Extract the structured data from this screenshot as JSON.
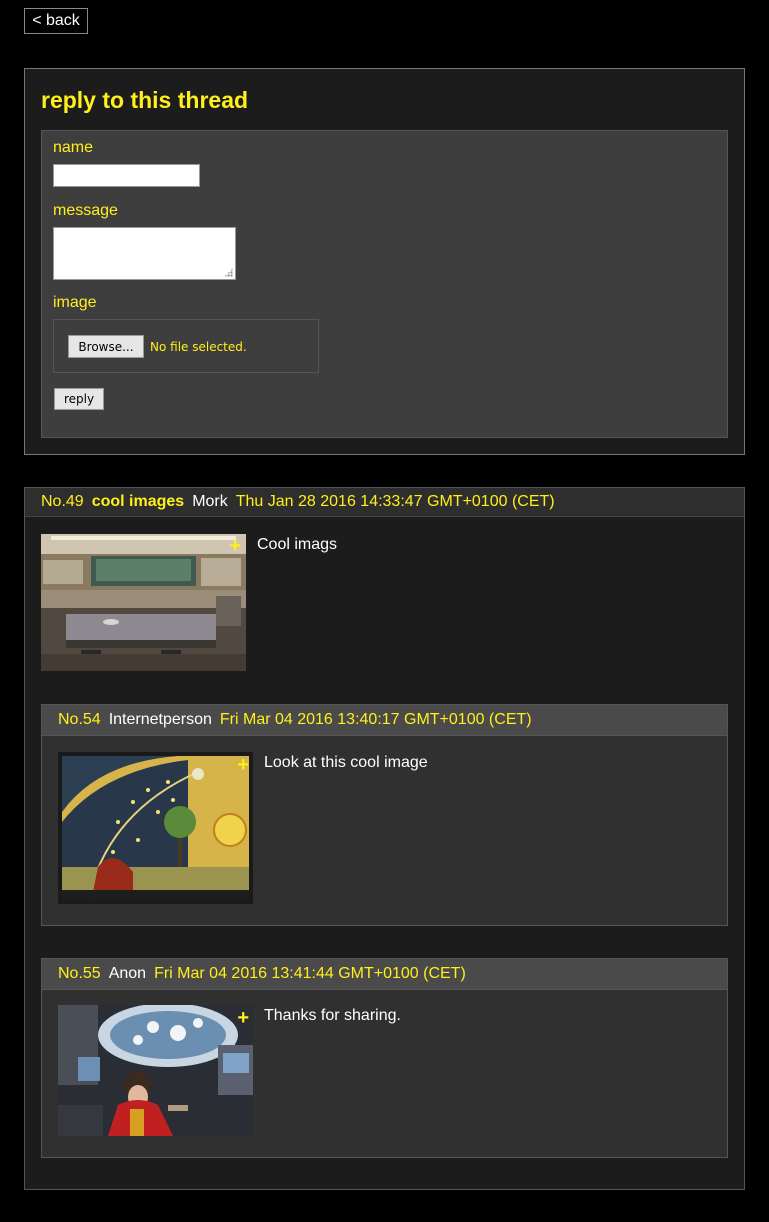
{
  "nav": {
    "back_label": "< back"
  },
  "reply_form": {
    "title": "reply to this thread",
    "name_label": "name",
    "message_label": "message",
    "image_label": "image",
    "browse_label": "Browse...",
    "file_status": "No file selected.",
    "submit_label": "reply",
    "name_value": "",
    "message_value": ""
  },
  "op": {
    "number": "No.49",
    "title": "cool images",
    "author": "Mork",
    "date": "Thu Jan 28 2016 14:33:47 GMT+0100 (CET)",
    "text": "Cool imags",
    "expand": "+"
  },
  "replies": [
    {
      "number": "No.54",
      "author": "Internetperson",
      "date": "Fri Mar 04 2016 13:40:17 GMT+0100 (CET)",
      "text": "Look at this cool image",
      "expand": "+"
    },
    {
      "number": "No.55",
      "author": "Anon",
      "date": "Fri Mar 04 2016 13:41:44 GMT+0100 (CET)",
      "text": "Thanks for sharing.",
      "expand": "+"
    }
  ],
  "colors": {
    "accent": "#ffef1a",
    "background": "#000000",
    "panel": "#1c1c1c"
  }
}
